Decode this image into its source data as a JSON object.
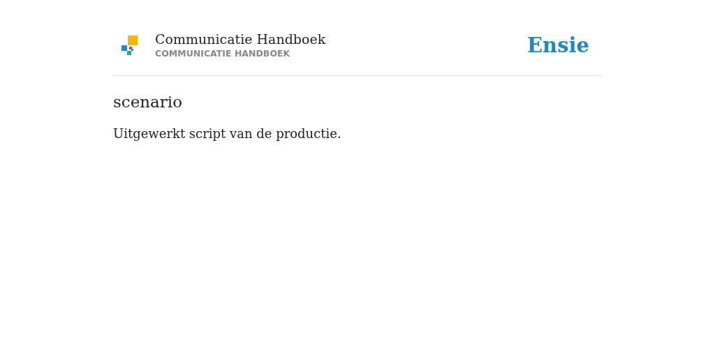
{
  "header": {
    "title": "Communicatie Handboek",
    "subtitle": "COMMUNICATIE HANDBOEK",
    "brand": "Ensie"
  },
  "term": "scenario",
  "definition": "Uitgewerkt script van de productie."
}
